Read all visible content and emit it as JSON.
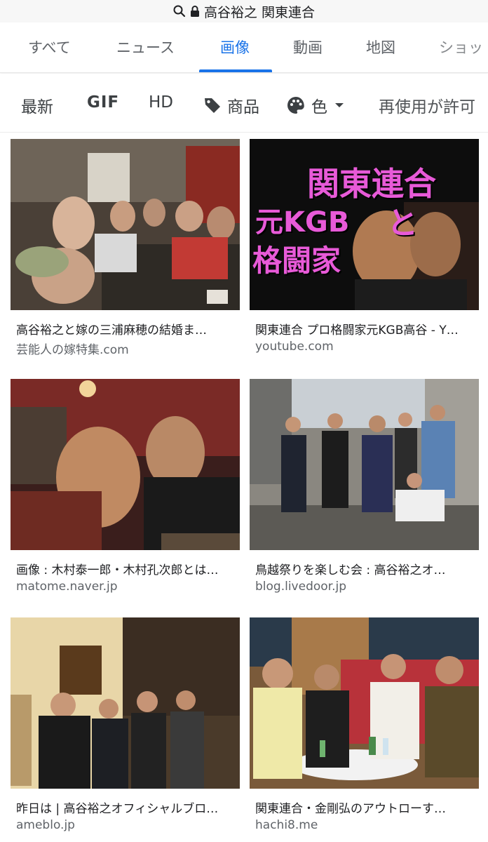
{
  "urlbar": {
    "query": "高谷裕之 関東連合",
    "icons": [
      "search-icon",
      "lock-icon"
    ]
  },
  "tabs": [
    {
      "label": "すべて",
      "active": false
    },
    {
      "label": "ニュース",
      "active": false
    },
    {
      "label": "画像",
      "active": true
    },
    {
      "label": "動画",
      "active": false
    },
    {
      "label": "地図",
      "active": false
    },
    {
      "label": "ショッ",
      "active": false
    }
  ],
  "filters": {
    "latest": "最新",
    "gif": "GIF",
    "hd": "HD",
    "products": "商品",
    "color": "色",
    "reuse": "再使用が許可"
  },
  "results": [
    {
      "caption": "高谷裕之と嫁の三浦麻穂の結婚ま…",
      "source": "芸能人の嫁特集.com"
    },
    {
      "caption": "関東連合 プロ格闘家元KGB高谷 - Y…",
      "source": "youtube.com",
      "overlay": {
        "line1": "関東連合",
        "line2": "元KGB",
        "line3": "と",
        "line4": "格闘家"
      }
    },
    {
      "caption": "画像 : 木村泰一郎・木村孔次郎とは…",
      "source": "matome.naver.jp"
    },
    {
      "caption": "鳥越祭りを楽しむ会 : 高谷裕之オ…",
      "source": "blog.livedoor.jp"
    },
    {
      "caption": "昨日は | 高谷裕之オフィシャルブロ…",
      "source": "ameblo.jp"
    },
    {
      "caption": "関東連合・金剛弘のアウトローす…",
      "source": "hachi8.me"
    }
  ],
  "colors": {
    "accent": "#1a73e8",
    "text": "#202124",
    "muted": "#5f6368",
    "overlay_text": "#e85ad8"
  }
}
